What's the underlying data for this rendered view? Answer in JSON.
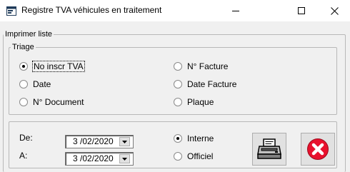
{
  "window": {
    "title": "Registre TVA véhicules en traitement",
    "icons": {
      "app": "app-icon",
      "minimize": "minimize-icon",
      "maximize": "maximize-icon",
      "close": "close-icon"
    }
  },
  "print_group": {
    "legend": "Imprimer liste"
  },
  "sort_group": {
    "legend": "Triage",
    "options": [
      {
        "label": "No inscr TVA",
        "selected": true
      },
      {
        "label": "Date",
        "selected": false
      },
      {
        "label": "N° Document",
        "selected": false
      },
      {
        "label": "N° Facture",
        "selected": false
      },
      {
        "label": "Date Facture",
        "selected": false
      },
      {
        "label": "Plaque",
        "selected": false
      }
    ]
  },
  "range": {
    "from_label": "De:",
    "from_value": "3 /02/2020",
    "to_label": "A:",
    "to_value": "3 /02/2020"
  },
  "mode": {
    "options": [
      {
        "label": "Interne",
        "selected": true
      },
      {
        "label": "Officiel",
        "selected": false
      }
    ]
  },
  "buttons": {
    "print_icon": "printer-icon",
    "cancel_icon": "cancel-icon"
  },
  "colors": {
    "cancel_red": "#e8112d",
    "titlebar": "#ffffff",
    "dialog": "#f0f0f0"
  }
}
